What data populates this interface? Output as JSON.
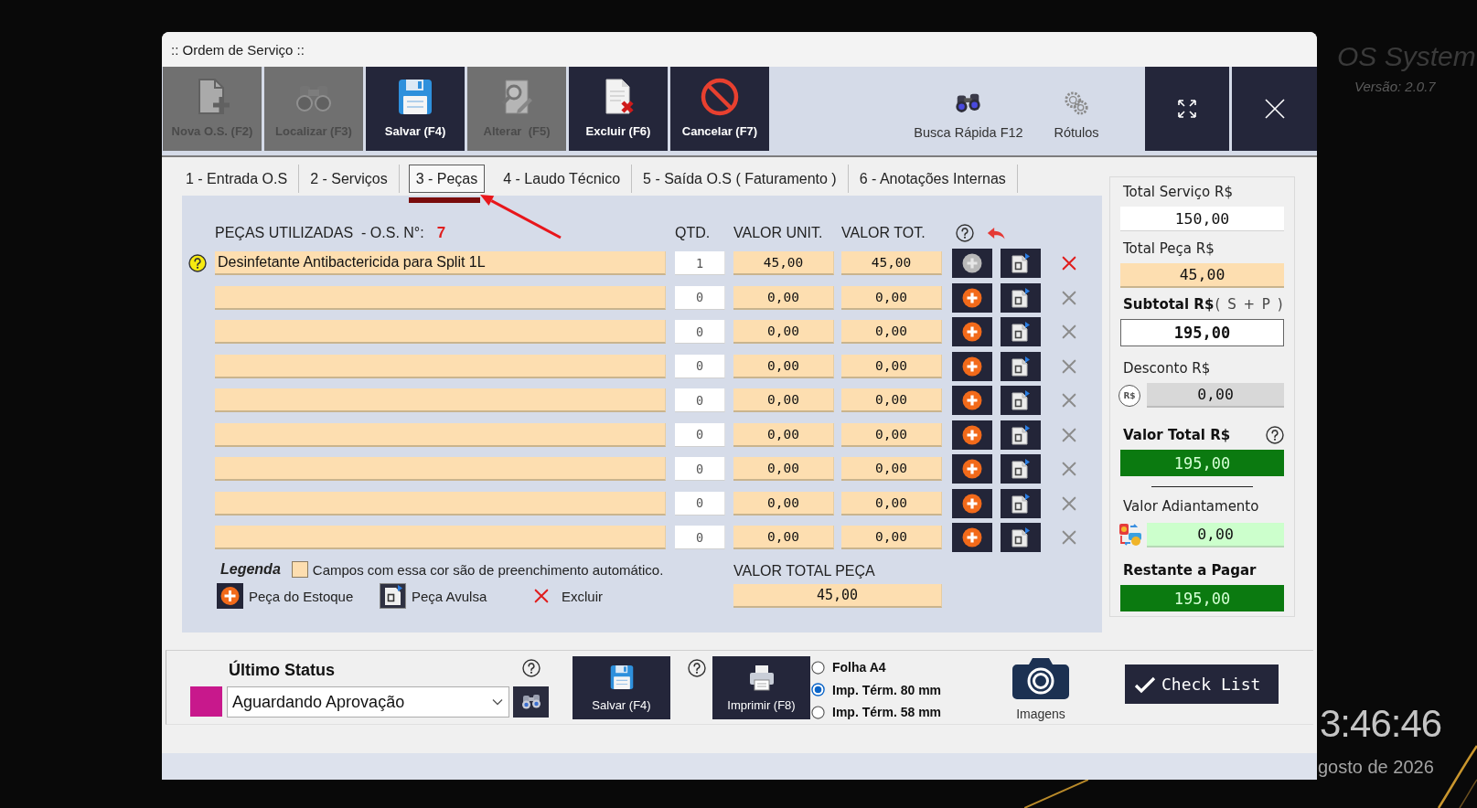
{
  "window": {
    "title": ":: Ordem de Serviço ::"
  },
  "toolbar": {
    "buttons": [
      {
        "kind": "new",
        "label": "Nova O.S. (F2)",
        "disabled": true
      },
      {
        "kind": "find",
        "label": "Localizar (F3)",
        "disabled": true
      },
      {
        "kind": "save",
        "label": "Salvar (F4)",
        "disabled": false
      },
      {
        "kind": "edit",
        "label": "Alterar  (F5)",
        "disabled": true
      },
      {
        "kind": "delete",
        "label": "Excluir (F6)",
        "disabled": false
      },
      {
        "kind": "cancel",
        "label": "Cancelar (F7)",
        "disabled": false
      }
    ],
    "quick": [
      {
        "kind": "search",
        "label": "Busca Rápida F12"
      },
      {
        "kind": "labels",
        "label": "Rótulos"
      }
    ]
  },
  "tabs": [
    {
      "label": "1 - Entrada O.S",
      "selected": false
    },
    {
      "label": "2 - Serviços",
      "selected": false
    },
    {
      "label": "3 - Peças",
      "selected": true
    },
    {
      "label": "4 - Laudo Técnico",
      "selected": false
    },
    {
      "label": "5 - Saída O.S ( Faturamento )",
      "selected": false
    },
    {
      "label": "6 - Anotações Internas",
      "selected": false
    }
  ],
  "parts": {
    "title": "PEÇAS UTILIZADAS  - O.S. N°:",
    "os_number": "7",
    "columns": [
      "QTD.",
      "VALOR UNIT.",
      "VALOR TOT."
    ],
    "rows": [
      {
        "description": "Desinfetante Antibactericida para Split 1L",
        "qty": "1",
        "unit_value": "45,00",
        "total_value": "45,00",
        "filled": true
      },
      {
        "qty": "0",
        "unit_value": "0,00",
        "total_value": "0,00",
        "filled": false
      },
      {
        "qty": "0",
        "unit_value": "0,00",
        "total_value": "0,00",
        "filled": false
      },
      {
        "qty": "0",
        "unit_value": "0,00",
        "total_value": "0,00",
        "filled": false
      },
      {
        "qty": "0",
        "unit_value": "0,00",
        "total_value": "0,00",
        "filled": false
      },
      {
        "qty": "0",
        "unit_value": "0,00",
        "total_value": "0,00",
        "filled": false
      },
      {
        "qty": "0",
        "unit_value": "0,00",
        "total_value": "0,00",
        "filled": false
      },
      {
        "qty": "0",
        "unit_value": "0,00",
        "total_value": "0,00",
        "filled": false
      },
      {
        "qty": "0",
        "unit_value": "0,00",
        "total_value": "0,00",
        "filled": false
      }
    ]
  },
  "legend": {
    "title": "Legenda",
    "note": "Campos com essa cor são de preenchimento automático.",
    "items": [
      {
        "kind": "stock",
        "label": "Peça do Estoque"
      },
      {
        "kind": "loose",
        "label": "Peça Avulsa"
      },
      {
        "kind": "delete",
        "label": "Excluir"
      }
    ]
  },
  "parts_total": {
    "label": "VALOR TOTAL PEÇA",
    "value": "45,00"
  },
  "totals": [
    {
      "kind": "service",
      "label": "Total Serviço R$",
      "value": "150,00"
    },
    {
      "kind": "parts",
      "label": "Total Peça R$",
      "value": "45,00"
    },
    {
      "kind": "subtotal",
      "label": "Subtotal R$",
      "note": "( S + P )",
      "value": "195,00"
    },
    {
      "kind": "discount",
      "label": "Desconto R$",
      "badge": "R$",
      "value": "0,00"
    },
    {
      "kind": "total",
      "label": "Valor Total R$",
      "value": "195,00"
    },
    {
      "kind": "advance",
      "label": "Valor Adiantamento",
      "value": "0,00"
    },
    {
      "kind": "remaining",
      "label": "Restante a Pagar",
      "value": "195,00"
    }
  ],
  "status": {
    "title": "Último Status",
    "value": "Aguardando Aprovação",
    "color": "#c8188c"
  },
  "save_button": {
    "label": "Salvar (F4)"
  },
  "print_button": {
    "label": "Imprimir (F8)"
  },
  "print_options": [
    {
      "label": "Folha A4",
      "selected": false
    },
    {
      "label": "Imp. Térm. 80 mm",
      "selected": true
    },
    {
      "label": "Imp. Térm. 58 mm",
      "selected": false
    }
  ],
  "images_button": {
    "label": "Imagens"
  },
  "check_list_button": {
    "label": "Check List"
  },
  "desktop": {
    "app_name": "OS System",
    "version": "Versão: 2.0.7",
    "clock": "3:46:46",
    "date": "gosto de 2026"
  }
}
